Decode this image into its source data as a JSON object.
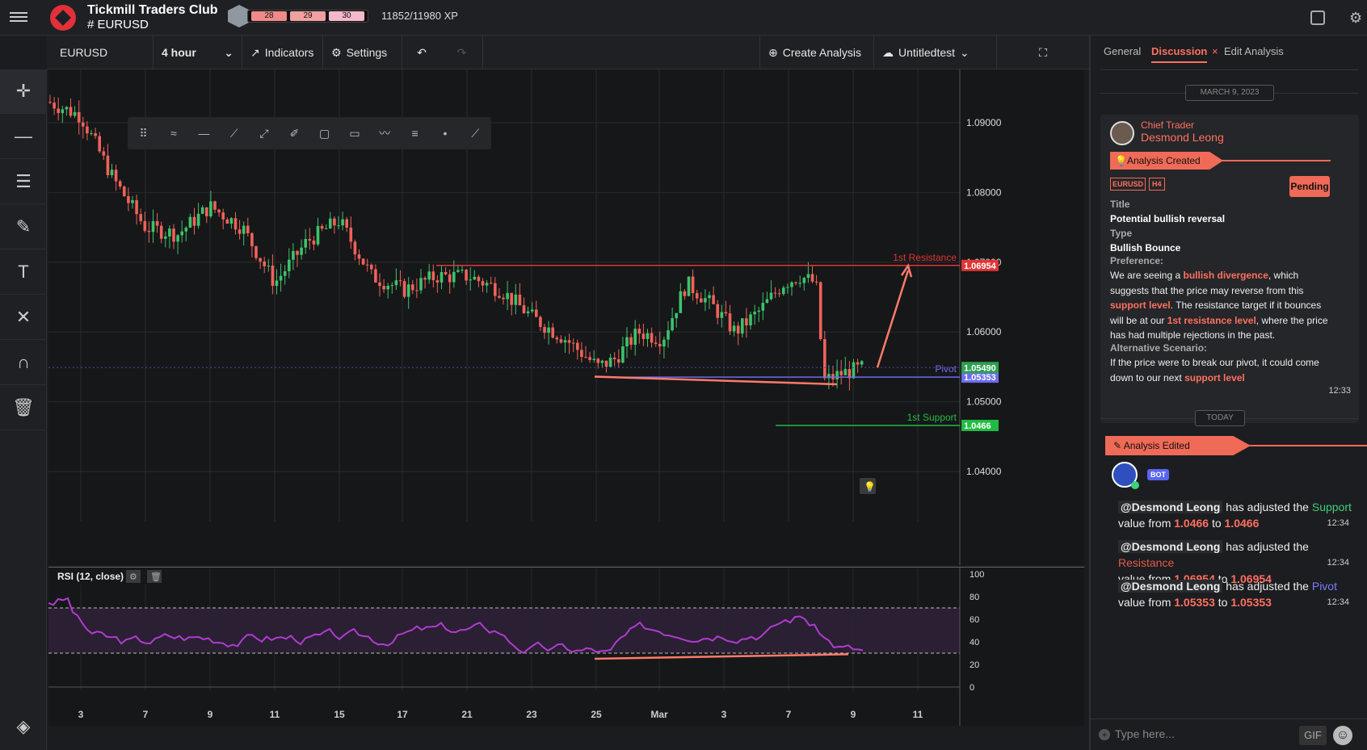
{
  "app": {
    "club": "Tickmill Traders Club",
    "room": "# EURUSD",
    "xp_levels": [
      "28",
      "29",
      "30"
    ],
    "xp_text": "11852/11980 XP",
    "xp_progress": 0.989
  },
  "toolbar": {
    "symbol": "EURUSD",
    "interval": "4 hour",
    "indicators": "Indicators",
    "settings": "Settings",
    "create": "Create Analysis",
    "layout": "Untitledtest"
  },
  "chart": {
    "price_ticks": [
      "1.09000",
      "1.08000",
      "1.07000",
      "1.06000",
      "1.05000",
      "1.04000"
    ],
    "price_values": [
      1.09,
      1.08,
      1.07,
      1.06,
      1.05,
      1.04
    ],
    "date_ticks": [
      "3",
      "7",
      "9",
      "11",
      "15",
      "17",
      "21",
      "23",
      "25",
      "Mar",
      "3",
      "7",
      "9",
      "11"
    ],
    "levels": [
      {
        "name": "1st Resistance",
        "value": 1.06954,
        "label": "1.06954",
        "color": "#e23434"
      },
      {
        "name": "Pivot",
        "value": 1.05353,
        "label": "1.05353",
        "color": "#6c6cf0"
      },
      {
        "name": "1st Support",
        "value": 1.0466,
        "label": "1.0466",
        "color": "#22bb44"
      }
    ],
    "last_price": {
      "value": 1.0549,
      "label": "1.05490"
    },
    "rsi_label": "RSI (12, close)",
    "rsi_ticks": [
      "100",
      "80",
      "60",
      "40",
      "20",
      "0"
    ]
  },
  "panel": {
    "tabs": [
      "General",
      "Discussion",
      "Edit Analysis"
    ],
    "date1": "MARCH 9, 2023",
    "date2": "TODAY",
    "author_role": "Chief Trader",
    "author_name": "Desmond Leong",
    "created": "Analysis Created",
    "tag1": "EURUSD",
    "tag2": "H4",
    "status": "Pending",
    "title_label": "Title",
    "title": "Potential bullish reversal",
    "type_label": "Type",
    "type": "Bullish Bounce",
    "pref_label": "Preference:",
    "pref_1": "We are seeing a ",
    "pref_hl1": "bullish divergence",
    "pref_2": ", which suggests that the price may reverse from this ",
    "pref_hl2": "support level",
    "pref_3": ". The resistance target if it bounces will be at our ",
    "pref_hl3": "1st resistance level",
    "pref_4": ", where the price has had multiple rejections in the past.",
    "alt_label": "Alternative Scenario:",
    "alt_1": "If the price were to break our pivot, it could come down to our next ",
    "alt_hl": "support level",
    "time1": "12:33",
    "edited": "Analysis Edited",
    "bot": "BOT",
    "messages": [
      {
        "user": "@Desmond Leong",
        "pre": " has adjusted the ",
        "field": "Support",
        "mid": "value from ",
        "from": "1.0466",
        "to_w": " to ",
        "to": "1.0466",
        "time": "12:34",
        "color": "#3fd07a"
      },
      {
        "user": "@Desmond Leong",
        "pre": " has adjusted the ",
        "field": "Resistance",
        "mid": " value from ",
        "from": "1.06954",
        "to_w": " to ",
        "to": "1.06954",
        "time": "12:34",
        "color": "#e25a4a"
      },
      {
        "user": "@Desmond Leong",
        "pre": " has adjusted the ",
        "field": "Pivot",
        "mid": "value from ",
        "from": "1.05353",
        "to_w": " to ",
        "to": "1.05353",
        "time": "12:34",
        "color": "#7b7bff"
      }
    ],
    "input_placeholder": "Type here...",
    "gif": "GIF"
  }
}
